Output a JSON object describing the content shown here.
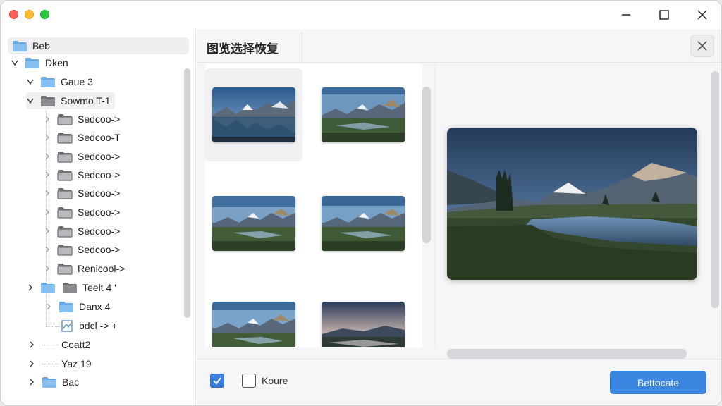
{
  "dialog": {
    "title": "图览选择恢复"
  },
  "tree": {
    "items": [
      {
        "label": "Beb"
      },
      {
        "label": "Dken"
      },
      {
        "label": "Gaue 3"
      },
      {
        "label": "Sowmo T-1"
      },
      {
        "label": "Sedcoo->"
      },
      {
        "label": "Sedcoo-T"
      },
      {
        "label": "Sedcoo->"
      },
      {
        "label": "Sedcoo->"
      },
      {
        "label": "Sedcoo->"
      },
      {
        "label": "Sedcoo->"
      },
      {
        "label": "Sedcoo->"
      },
      {
        "label": "Sedcoo->"
      },
      {
        "label": "Renicool->"
      },
      {
        "label": "Teelt 4 '"
      },
      {
        "label": "Danx 4"
      },
      {
        "label": "bdcl ->  +"
      },
      {
        "label": "Coatt2"
      },
      {
        "label": "Yaz 19"
      },
      {
        "label": "Bac"
      }
    ]
  },
  "footer": {
    "checkbox_label": "Koure",
    "primary_button": "Bettocate"
  },
  "colors": {
    "accent": "#3b86e0",
    "folder_blue": "#7fb8ea",
    "folder_gray": "#8a8a8f"
  }
}
